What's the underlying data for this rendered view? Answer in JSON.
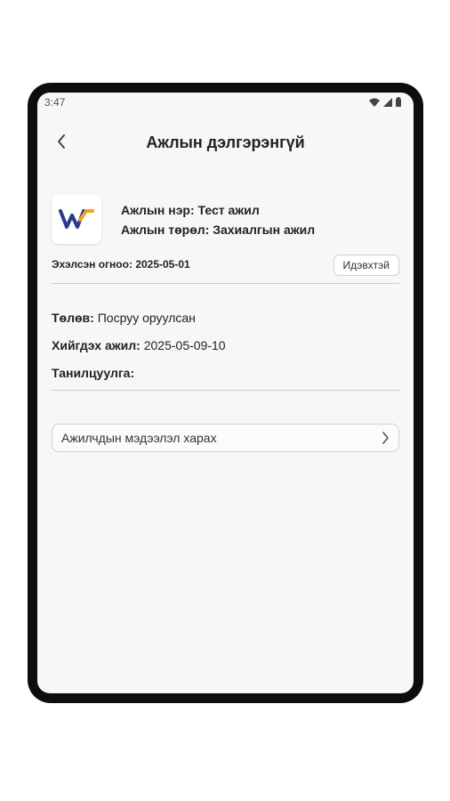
{
  "status_bar": {
    "time": "3:47"
  },
  "header": {
    "title": "Ажлын дэлгэрэнгүй"
  },
  "job": {
    "name_label": "Ажлын нэр:",
    "name_value": "Тест ажил",
    "type_label": "Ажлын төрөл:",
    "type_value": "Захиалгын ажил",
    "start_label": "Эхэлсэн огноо:",
    "start_value": "2025-05-01",
    "status_chip": "Идэвхтэй"
  },
  "details": {
    "state_label": "Төлөв:",
    "state_value": "Посруу оруулсан",
    "task_label": "Хийгдэх ажил:",
    "task_value": "2025-05-09-10",
    "intro_label": "Танилцуулга:"
  },
  "actions": {
    "view_worker_info": "Ажилчдын мэдээлэл харах"
  },
  "colors": {
    "logo_blue": "#2b3a8f",
    "logo_orange": "#f0a020",
    "background": "#f7f7f8"
  },
  "icons": [
    "wifi-icon",
    "signal-icon",
    "battery-icon",
    "back-arrow-icon",
    "company-logo-icon",
    "chevron-right-icon"
  ]
}
